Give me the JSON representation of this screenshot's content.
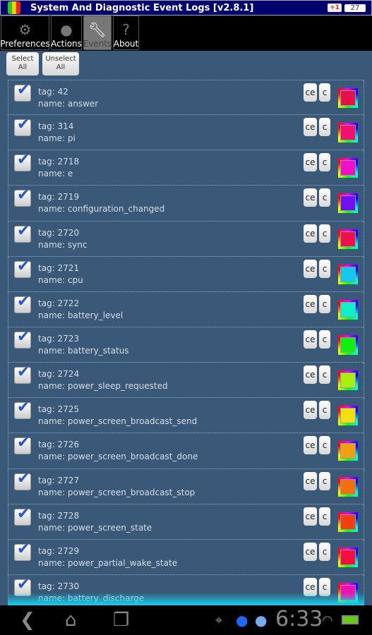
{
  "app": {
    "title": "System And Diagnostic Event Logs [v2.8.1]",
    "gplus_label": "+1",
    "gplus_count": "27"
  },
  "tabs": [
    {
      "label": "Preferences",
      "icon": "gear-document-icon"
    },
    {
      "label": "Actions",
      "icon": "lightbulb-icon"
    },
    {
      "label": "Events",
      "icon": "wrench-icon",
      "active": true
    },
    {
      "label": "About",
      "icon": "question-bubble-icon"
    }
  ],
  "buttons": {
    "select_all": "Select All",
    "unselect_all": "Unselect All"
  },
  "row_buttons": {
    "ce": "ce",
    "c": "c"
  },
  "events": [
    {
      "tag": "tag: 42",
      "name": "name: answer",
      "checked": true,
      "color": "#e8104a"
    },
    {
      "tag": "tag: 314",
      "name": "name: pi",
      "checked": true,
      "color": "#f01070"
    },
    {
      "tag": "tag: 2718",
      "name": "name: e",
      "checked": true,
      "color": "#f010c8"
    },
    {
      "tag": "tag: 2719",
      "name": "name: configuration_changed",
      "checked": true,
      "color": "#7010f0"
    },
    {
      "tag": "tag: 2720",
      "name": "name: sync",
      "checked": true,
      "color": "#f01050"
    },
    {
      "tag": "tag: 2721",
      "name": "name: cpu",
      "checked": true,
      "color": "#10c8f0"
    },
    {
      "tag": "tag: 2722",
      "name": "name: battery_level",
      "checked": true,
      "color": "#10f0c8"
    },
    {
      "tag": "tag: 2723",
      "name": "name: battery_status",
      "checked": true,
      "color": "#10f010"
    },
    {
      "tag": "tag: 2724",
      "name": "name: power_sleep_requested",
      "checked": true,
      "color": "#a8f010"
    },
    {
      "tag": "tag: 2725",
      "name": "name: power_screen_broadcast_send",
      "checked": true,
      "color": "#f0e010"
    },
    {
      "tag": "tag: 2726",
      "name": "name: power_screen_broadcast_done",
      "checked": true,
      "color": "#f0a010"
    },
    {
      "tag": "tag: 2727",
      "name": "name: power_screen_broadcast_stop",
      "checked": true,
      "color": "#f07010"
    },
    {
      "tag": "tag: 2728",
      "name": "name: power_screen_state",
      "checked": true,
      "color": "#f04010"
    },
    {
      "tag": "tag: 2729",
      "name": "name: power_partial_wake_state",
      "checked": true,
      "color": "#f01040"
    },
    {
      "tag": "tag: 2730",
      "name": "name: battery_discharge",
      "checked": true,
      "color": "#f010b0"
    }
  ],
  "statusbar": {
    "time": "6:33"
  }
}
